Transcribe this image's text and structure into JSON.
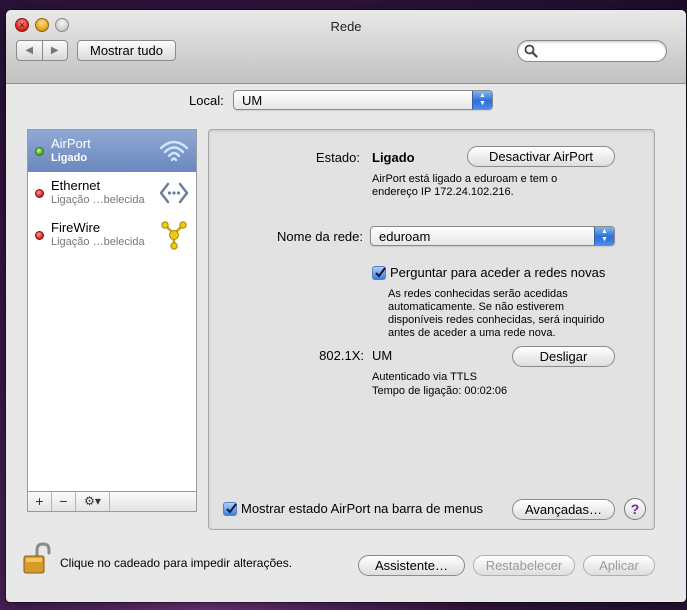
{
  "window": {
    "title": "Rede"
  },
  "toolbar": {
    "back_label": "◀",
    "forward_label": "▶",
    "show_all_label": "Mostrar tudo",
    "search_placeholder": ""
  },
  "location": {
    "label": "Local:",
    "value": "UM"
  },
  "sidebar": {
    "items": [
      {
        "name": "AirPort",
        "status": "Ligado",
        "status_color": "green",
        "icon": "wifi-icon",
        "selected": true
      },
      {
        "name": "Ethernet",
        "status": "Ligação …belecida",
        "status_color": "red",
        "icon": "ethernet-icon",
        "selected": false
      },
      {
        "name": "FireWire",
        "status": "Ligação …belecida",
        "status_color": "red",
        "icon": "firewire-icon",
        "selected": false
      }
    ],
    "add_label": "+",
    "remove_label": "−",
    "action_label": "⚙▾"
  },
  "detail": {
    "status_label": "Estado:",
    "status_value": "Ligado",
    "turn_off_button": "Desactivar AirPort",
    "status_desc_1": "AirPort está ligado a eduroam e tem o",
    "status_desc_2": "endereço IP 172.24.102.216.",
    "network_label": "Nome da rede:",
    "network_value": "eduroam",
    "ask_checkbox_label": "Perguntar para aceder a redes novas",
    "ask_checked": true,
    "ask_desc_1": "As redes conhecidas serão acedidas",
    "ask_desc_2": "automaticamente. Se não estiverem",
    "ask_desc_3": "disponíveis redes conhecidas, será inquirido",
    "ask_desc_4": "antes de aceder a uma rede nova.",
    "dot1x_label": "802.1X:",
    "dot1x_value": "UM",
    "disconnect_button": "Desligar",
    "auth_info": "Autenticado via TTLS",
    "connect_time": "Tempo de ligação: 00:02:06",
    "show_status_label": "Mostrar estado AirPort na barra de menus",
    "show_status_checked": true,
    "advanced_button": "Avançadas…",
    "help_label": "?"
  },
  "footer": {
    "lock_text": "Clique no cadeado para impedir alterações.",
    "assistant_button": "Assistente…",
    "revert_button": "Restabelecer",
    "apply_button": "Aplicar"
  },
  "colors": {
    "accent": "#3d7fe0",
    "selection": "#7a95c8",
    "status_ok": "#3aa51a",
    "status_off": "#d01a1a"
  }
}
